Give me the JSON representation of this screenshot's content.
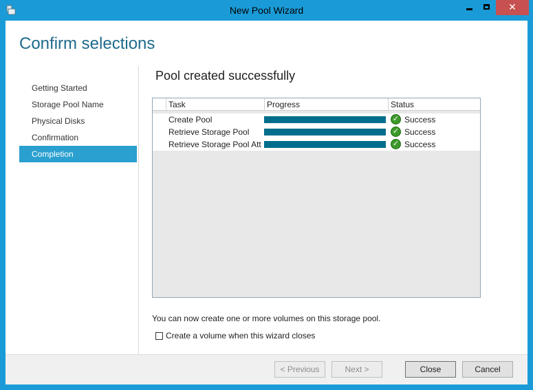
{
  "window": {
    "title": "New Pool Wizard",
    "close_glyph": "✕"
  },
  "page": {
    "title": "Confirm selections",
    "heading": "Pool created successfully"
  },
  "nav": {
    "items": [
      {
        "label": "Getting Started",
        "active": false
      },
      {
        "label": "Storage Pool Name",
        "active": false
      },
      {
        "label": "Physical Disks",
        "active": false
      },
      {
        "label": "Confirmation",
        "active": false
      },
      {
        "label": "Completion",
        "active": true
      }
    ]
  },
  "grid": {
    "headers": {
      "task": "Task",
      "progress": "Progress",
      "status": "Status"
    },
    "rows": [
      {
        "task": "Create Pool",
        "progress": 1.0,
        "status": "Success"
      },
      {
        "task": "Retrieve Storage Pool",
        "progress": 1.0,
        "status": "Success"
      },
      {
        "task": "Retrieve Storage Pool Att",
        "progress": 1.0,
        "status": "Success"
      }
    ]
  },
  "info_text": "You can now create one or more volumes on this storage pool.",
  "checkbox": {
    "label": "Create a volume when this wizard closes",
    "checked": false
  },
  "buttons": {
    "previous": "< Previous",
    "next": "Next >",
    "close": "Close",
    "cancel": "Cancel"
  },
  "icons": {
    "success": "check-circle-icon"
  },
  "colors": {
    "accent": "#1a9bd7",
    "progress": "#006e8c",
    "success": "#3c9a2a"
  }
}
